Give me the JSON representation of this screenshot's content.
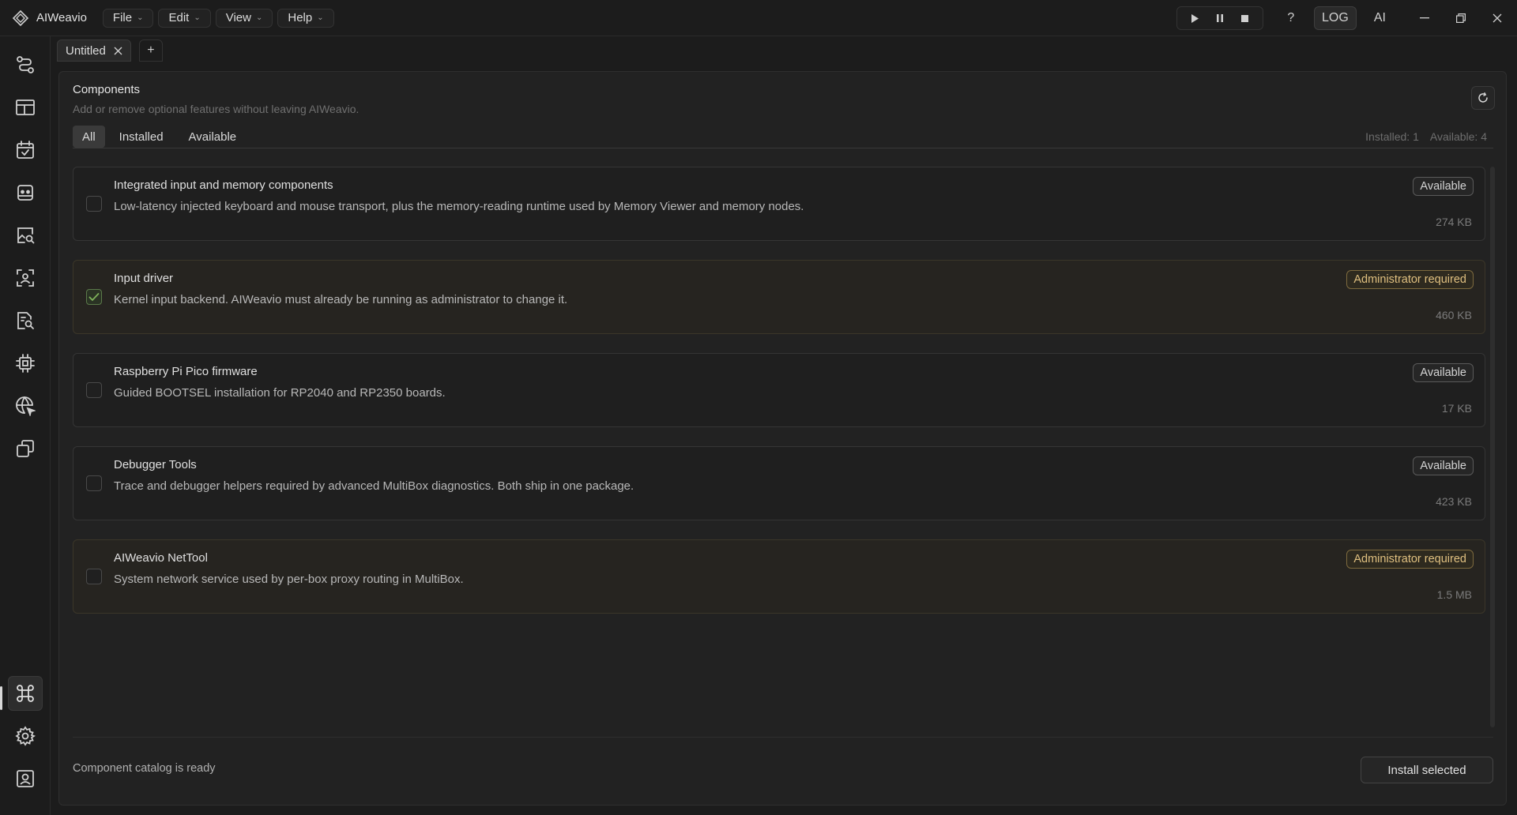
{
  "app": {
    "name": "AIWeavio"
  },
  "menus": [
    {
      "label": "File"
    },
    {
      "label": "Edit"
    },
    {
      "label": "View"
    },
    {
      "label": "Help"
    }
  ],
  "toolbar": {
    "help_label": "?",
    "log_label": "LOG",
    "ai_label": "AI"
  },
  "tabs": {
    "doc_title": "Untitled",
    "add_label": "+"
  },
  "components": {
    "title": "Components",
    "subtitle": "Add or remove optional features without leaving AIWeavio.",
    "filters": [
      {
        "label": "All",
        "active": true
      },
      {
        "label": "Installed",
        "active": false
      },
      {
        "label": "Available",
        "active": false
      }
    ],
    "installed_count": "Installed: 1",
    "available_count": "Available: 4",
    "items": [
      {
        "title": "Integrated input and memory components",
        "description": "Low-latency injected keyboard and mouse transport, plus the memory-reading runtime used by Memory Viewer and memory nodes.",
        "badge": "Available",
        "size": "274 KB",
        "checked": false
      },
      {
        "title": "Input driver",
        "description": "Kernel input backend. AIWeavio must already be running as administrator to change it.",
        "badge": "Administrator required",
        "size": "460 KB",
        "checked": true
      },
      {
        "title": "Raspberry Pi Pico firmware",
        "description": "Guided BOOTSEL installation for RP2040 and RP2350 boards.",
        "badge": "Available",
        "size": "17 KB",
        "checked": false
      },
      {
        "title": "Debugger Tools",
        "description": "Trace and debugger helpers required by advanced MultiBox diagnostics. Both ship in one package.",
        "badge": "Available",
        "size": "423 KB",
        "checked": false
      },
      {
        "title": "AIWeavio NetTool",
        "description": "System network service used by per-box proxy routing in MultiBox.",
        "badge": "Administrator required",
        "size": "1.5 MB",
        "checked": false
      }
    ],
    "status": "Component catalog is ready",
    "install_label": "Install selected"
  },
  "icons": {
    "sidebar": [
      "flow-icon",
      "layout-icon",
      "calendar-check-icon",
      "robot-icon",
      "image-search-icon",
      "face-scan-icon",
      "file-search-icon",
      "chip-icon",
      "globe-cursor-icon",
      "windows-icon",
      "command-icon",
      "settings-icon",
      "account-icon"
    ]
  },
  "colors": {
    "accent_admin": "#e0c080",
    "check_green": "#7fb35a"
  }
}
